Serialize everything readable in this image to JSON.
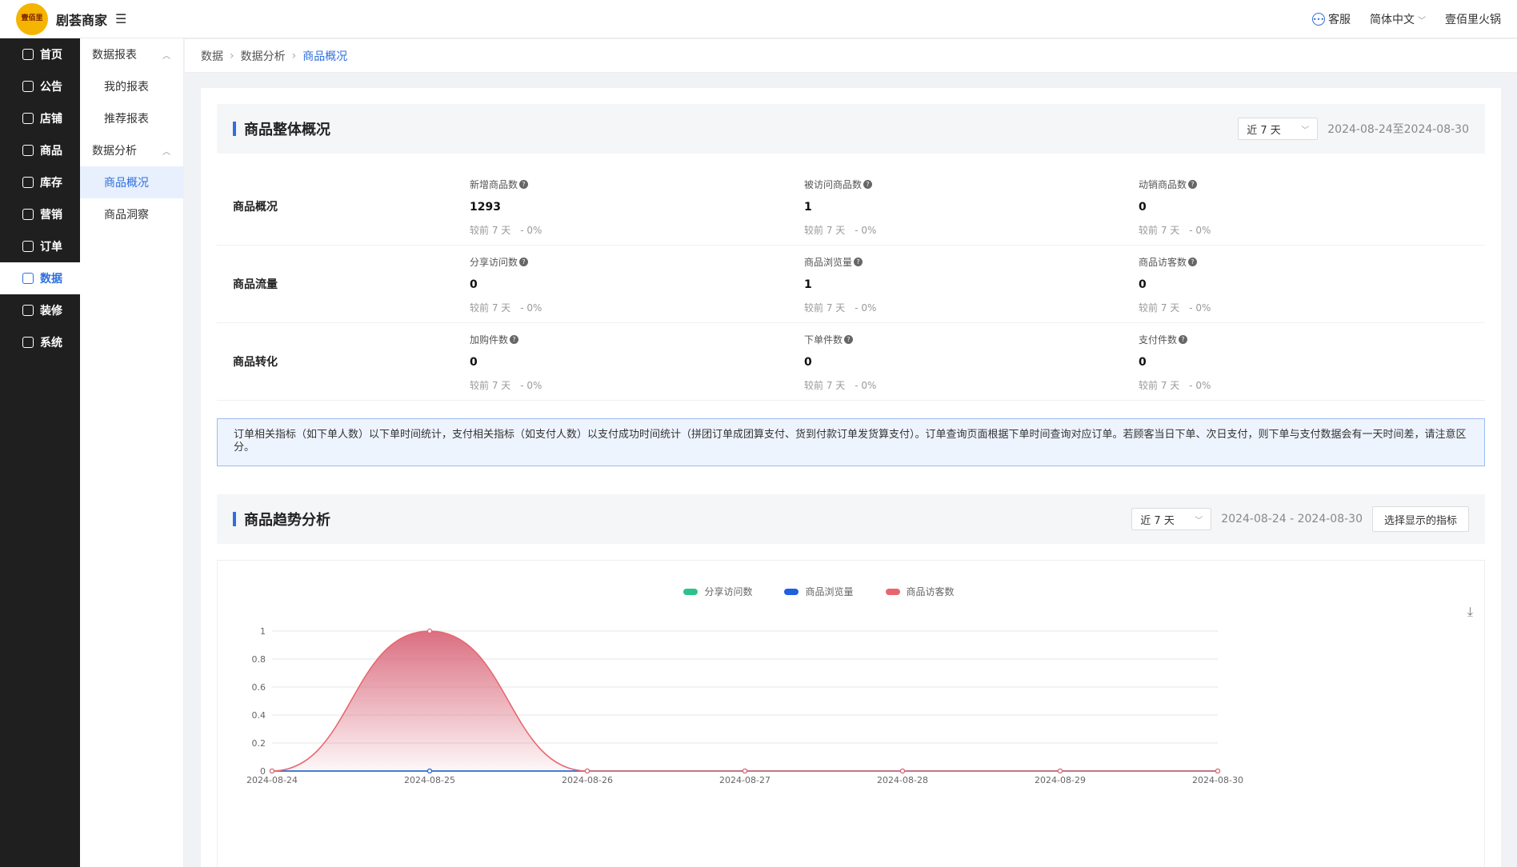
{
  "header": {
    "logo_text": "壹佰里",
    "brand": "剧荟商家",
    "menu_icon": "☰",
    "service_label": "客服",
    "language_label": "简体中文",
    "user_label": "壹佰里火锅"
  },
  "sidebar": {
    "items": [
      {
        "label": "首页",
        "icon": "home-icon"
      },
      {
        "label": "公告",
        "icon": "notice-icon"
      },
      {
        "label": "店铺",
        "icon": "store-icon"
      },
      {
        "label": "商品",
        "icon": "goods-icon"
      },
      {
        "label": "库存",
        "icon": "stock-icon"
      },
      {
        "label": "营销",
        "icon": "marketing-icon"
      },
      {
        "label": "订单",
        "icon": "order-icon"
      },
      {
        "label": "数据",
        "icon": "data-icon"
      },
      {
        "label": "装修",
        "icon": "decorate-icon"
      },
      {
        "label": "系统",
        "icon": "settings-icon"
      }
    ]
  },
  "submenu": {
    "group1": "数据报表",
    "group1_items": [
      "我的报表",
      "推荐报表"
    ],
    "group2": "数据分析",
    "group2_items": [
      "商品概况",
      "商品洞察"
    ]
  },
  "breadcrumb": [
    "数据",
    "数据分析",
    "商品概况"
  ],
  "overview": {
    "title": "商品整体概况",
    "range_select": "近 7 天",
    "date_range": "2024-08-24至2024-08-30",
    "rows": [
      {
        "label": "商品概况",
        "metrics": [
          {
            "name": "新增商品数",
            "value": "1293",
            "compare": "较前 7 天",
            "change": "- 0%"
          },
          {
            "name": "被访问商品数",
            "value": "1",
            "compare": "较前 7 天",
            "change": "- 0%"
          },
          {
            "name": "动销商品数",
            "value": "0",
            "compare": "较前 7 天",
            "change": "- 0%"
          }
        ]
      },
      {
        "label": "商品流量",
        "metrics": [
          {
            "name": "分享访问数",
            "value": "0",
            "compare": "较前 7 天",
            "change": "- 0%"
          },
          {
            "name": "商品浏览量",
            "value": "1",
            "compare": "较前 7 天",
            "change": "- 0%"
          },
          {
            "name": "商品访客数",
            "value": "0",
            "compare": "较前 7 天",
            "change": "- 0%"
          }
        ]
      },
      {
        "label": "商品转化",
        "metrics": [
          {
            "name": "加购件数",
            "value": "0",
            "compare": "较前 7 天",
            "change": "- 0%"
          },
          {
            "name": "下单件数",
            "value": "0",
            "compare": "较前 7 天",
            "change": "- 0%"
          },
          {
            "name": "支付件数",
            "value": "0",
            "compare": "较前 7 天",
            "change": "- 0%"
          }
        ]
      }
    ],
    "notice": "订单相关指标（如下单人数）以下单时间统计，支付相关指标（如支付人数）以支付成功时间统计（拼团订单成团算支付、货到付款订单发货算支付）。订单查询页面根据下单时间查询对应订单。若顾客当日下单、次日支付，则下单与支付数据会有一天时间差，请注意区分。"
  },
  "trend": {
    "title": "商品趋势分析",
    "range_select": "近 7 天",
    "date_range": "2024-08-24 - 2024-08-30",
    "indicator_button": "选择显示的指标"
  },
  "chart_data": {
    "type": "area",
    "x": [
      "2024-08-24",
      "2024-08-25",
      "2024-08-26",
      "2024-08-27",
      "2024-08-28",
      "2024-08-29",
      "2024-08-30"
    ],
    "yticks": [
      "0",
      "0.2",
      "0.4",
      "0.6",
      "0.8",
      "1"
    ],
    "ylim": [
      0,
      1
    ],
    "grid": true,
    "legend_position": "top-center",
    "series": [
      {
        "name": "分享访问数",
        "color": "#2ec28b",
        "values": [
          0,
          0,
          0,
          0,
          0,
          0,
          0
        ]
      },
      {
        "name": "商品浏览量",
        "color": "#1f5fe0",
        "values": [
          0,
          0,
          0,
          0,
          0,
          0,
          0
        ]
      },
      {
        "name": "商品访客数",
        "color": "#e8676f",
        "values": [
          0,
          1,
          0,
          0,
          0,
          0,
          0
        ]
      }
    ]
  }
}
